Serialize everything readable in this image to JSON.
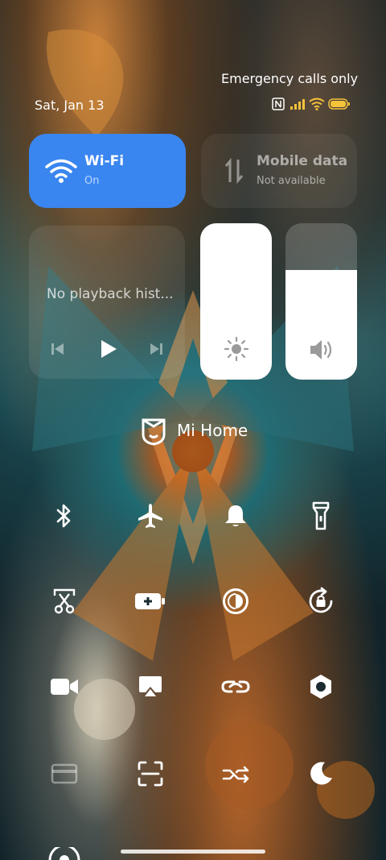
{
  "status_bar": {
    "carrier_text": "Emergency calls only",
    "date": "Sat, Jan 13"
  },
  "tiles": {
    "wifi": {
      "title": "Wi-Fi",
      "status": "On",
      "icon": "wifi-icon",
      "color": "#3a86f0"
    },
    "mobile": {
      "title": "Mobile data",
      "status": "Not available",
      "icon": "mobile-data-icon"
    }
  },
  "media": {
    "text": "No playback hist..."
  },
  "sliders": {
    "brightness": {
      "level": 1.0,
      "icon": "brightness-icon"
    },
    "volume": {
      "level": 0.7,
      "icon": "volume-icon"
    }
  },
  "mi_home": {
    "label": "Mi Home",
    "icon": "mi-home-icon"
  },
  "toggles": [
    {
      "name": "bluetooth",
      "icon": "bluetooth-icon"
    },
    {
      "name": "airplane-mode",
      "icon": "airplane-icon"
    },
    {
      "name": "ringer",
      "icon": "bell-icon"
    },
    {
      "name": "flashlight",
      "icon": "flashlight-icon"
    },
    {
      "name": "screenshot",
      "icon": "scissors-icon"
    },
    {
      "name": "battery-saver",
      "icon": "battery-plus-icon"
    },
    {
      "name": "dark-contrast",
      "icon": "contrast-icon"
    },
    {
      "name": "rotation-lock",
      "icon": "rotation-lock-icon"
    },
    {
      "name": "screen-recorder",
      "icon": "video-camera-icon"
    },
    {
      "name": "cast",
      "icon": "cast-icon"
    },
    {
      "name": "link",
      "icon": "link-icon"
    },
    {
      "name": "settings",
      "icon": "settings-hex-icon"
    },
    {
      "name": "card",
      "icon": "card-icon"
    },
    {
      "name": "scanner",
      "icon": "scan-icon"
    },
    {
      "name": "data-saver",
      "icon": "data-saver-icon"
    },
    {
      "name": "dark-mode",
      "icon": "moon-icon"
    }
  ]
}
